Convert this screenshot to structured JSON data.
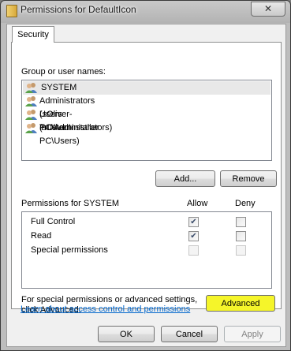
{
  "window": {
    "title": "Permissions for DefaultIcon",
    "close_symbol": "✕"
  },
  "tabs": [
    {
      "label": "Security",
      "selected": true
    }
  ],
  "group_section": {
    "label": "Group or user names:",
    "items": [
      {
        "label": "SYSTEM",
        "icon": "users-icon",
        "selected": true
      },
      {
        "label": "Administrators (sOliver-PC\\Administrators)",
        "icon": "users-icon"
      },
      {
        "label": "Users (sOliver-PC\\Users)",
        "icon": "users-icon"
      },
      {
        "label": "TrustedInstaller",
        "icon": "users-icon"
      }
    ],
    "add_button": "Add...",
    "remove_button": "Remove"
  },
  "permissions": {
    "label": "Permissions for SYSTEM",
    "allow_header": "Allow",
    "deny_header": "Deny",
    "rows": [
      {
        "name": "Full Control",
        "allow": true,
        "deny": false,
        "enabled": true
      },
      {
        "name": "Read",
        "allow": true,
        "deny": false,
        "enabled": true
      },
      {
        "name": "Special permissions",
        "allow": false,
        "deny": false,
        "enabled": false
      }
    ]
  },
  "advanced": {
    "text": "For special permissions or advanced settings, click Advanced.",
    "button": "Advanced",
    "highlight_color": "#f5f52a"
  },
  "link": "Learn about access control and permissions",
  "footer": {
    "ok": "OK",
    "cancel": "Cancel",
    "apply": "Apply"
  },
  "colors": {
    "link": "#0066cc",
    "selection": "#e8e8e8"
  }
}
